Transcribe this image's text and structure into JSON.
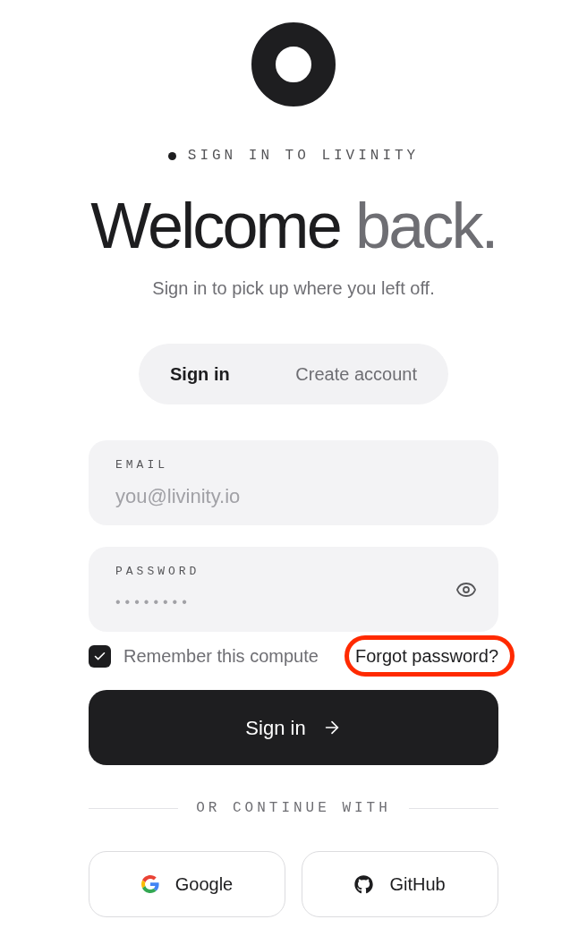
{
  "eyebrow": "SIGN IN TO LIVINITY",
  "heading": {
    "main": "Welcome",
    "accent": "back."
  },
  "subtitle": "Sign in to pick up where you left off.",
  "tabs": [
    {
      "label": "Sign in",
      "selected": true
    },
    {
      "label": "Create account",
      "selected": false
    }
  ],
  "fields": [
    {
      "kind": "email",
      "label": "EMAIL",
      "placeholder": "you@livinity.io"
    },
    {
      "kind": "password",
      "label": "PASSWORD",
      "placeholder": "••••••••"
    }
  ],
  "remember": {
    "label": "Remember this compute",
    "checked": true
  },
  "forgot_link": {
    "label": "Forgot password?",
    "highlighted": true
  },
  "submit_button": {
    "label": "Sign in"
  },
  "divider": "OR CONTINUE WITH",
  "social_buttons": [
    {
      "kind": "google",
      "label": "Google"
    },
    {
      "kind": "github",
      "label": "GitHub"
    }
  ]
}
